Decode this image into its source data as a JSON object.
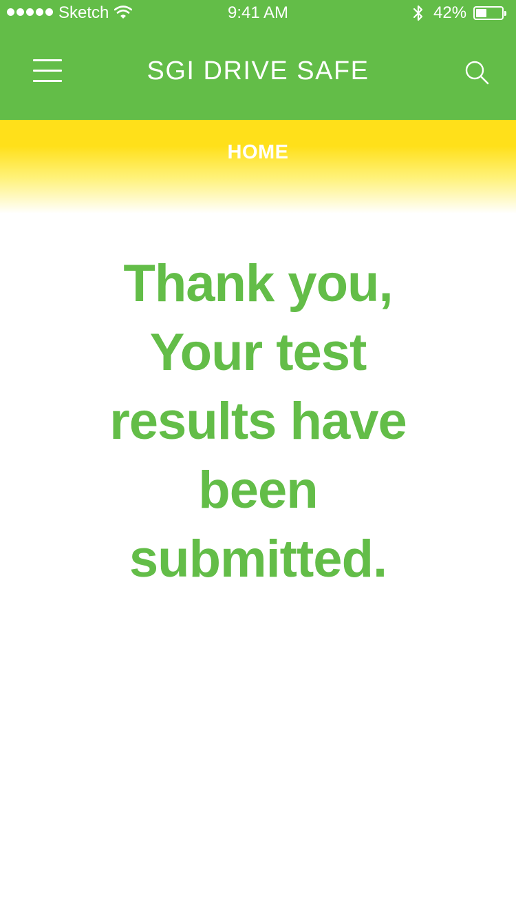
{
  "status_bar": {
    "carrier": "Sketch",
    "time": "9:41 AM",
    "battery_percent": "42%",
    "battery_level": 0.42,
    "icons": [
      "signal-dots-icon",
      "wifi-icon",
      "bluetooth-icon",
      "battery-icon"
    ]
  },
  "header": {
    "title": "SGI DRIVE SAFE",
    "menu_icon": "hamburger-menu-icon",
    "search_icon": "search-icon"
  },
  "breadcrumb": {
    "label": "HOME"
  },
  "message": {
    "lines": [
      "Thank you,",
      "Your test",
      "results have",
      "been",
      "submitted."
    ]
  },
  "colors": {
    "brand_green": "#63bd48",
    "accent_yellow": "#ffe01a",
    "background": "#ffffff"
  }
}
